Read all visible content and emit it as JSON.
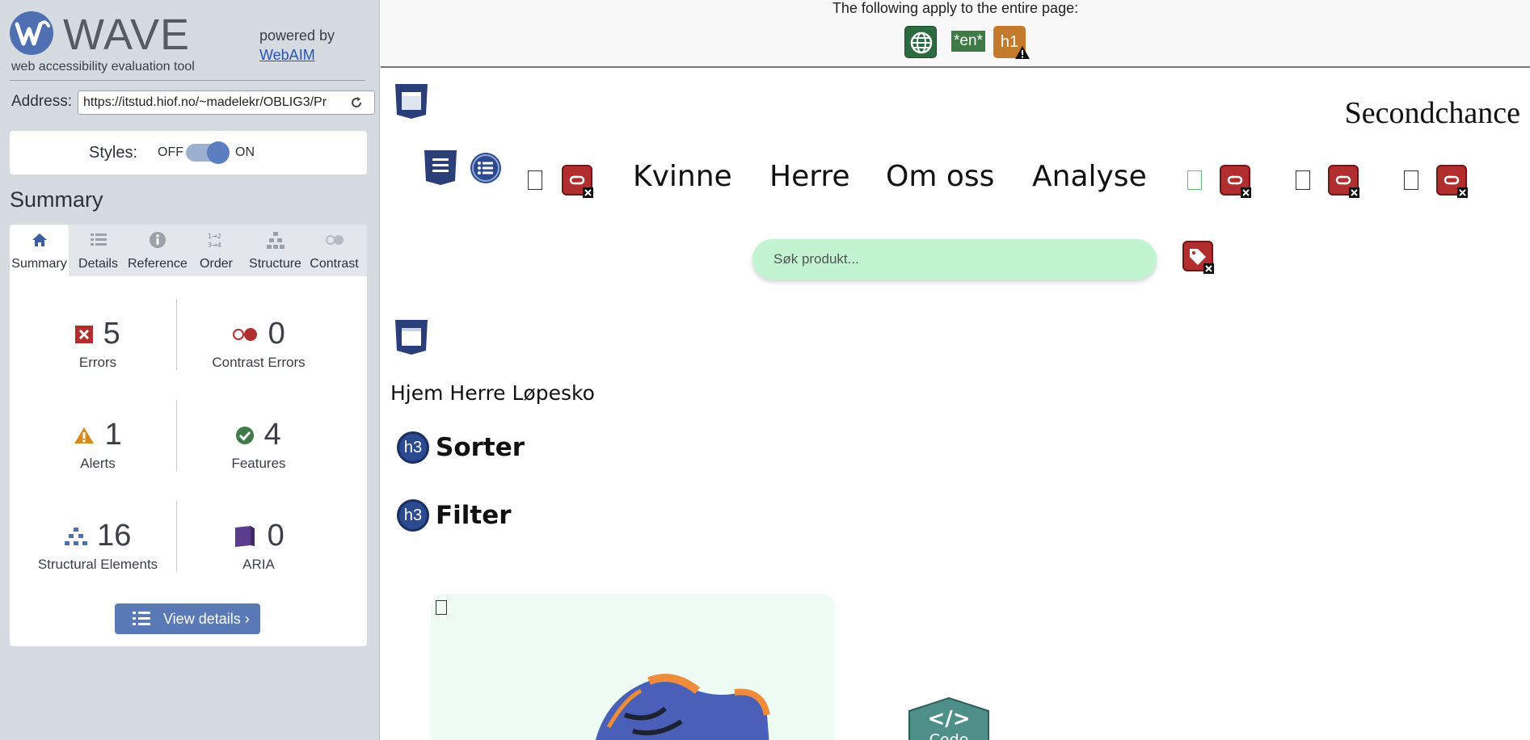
{
  "wave": {
    "title": "WAVE",
    "tagline": "web accessibility evaluation tool",
    "powered_by": "powered by",
    "webaim_link": "WebAIM",
    "address_label": "Address:",
    "address_value": "https://itstud.hiof.no/~madelekr/OBLIG3/Pr",
    "styles_label": "Styles:",
    "styles_off": "OFF",
    "styles_on": "ON",
    "summary_heading": "Summary",
    "tabs": [
      {
        "label": "Summary",
        "icon": "home-icon"
      },
      {
        "label": "Details",
        "icon": "list-icon"
      },
      {
        "label": "Reference",
        "icon": "info-icon"
      },
      {
        "label": "Order",
        "icon": "order-icon"
      },
      {
        "label": "Structure",
        "icon": "structure-icon"
      },
      {
        "label": "Contrast",
        "icon": "contrast-icon"
      }
    ],
    "stats": {
      "errors": {
        "count": "5",
        "label": "Errors"
      },
      "contrast": {
        "count": "0",
        "label": "Contrast Errors"
      },
      "alerts": {
        "count": "1",
        "label": "Alerts"
      },
      "features": {
        "count": "4",
        "label": "Features"
      },
      "structural": {
        "count": "16",
        "label": "Structural Elements"
      },
      "aria": {
        "count": "0",
        "label": "ARIA"
      }
    },
    "view_details": "View details ›",
    "colors": {
      "error": "#b22e2e",
      "alert": "#d88a1e",
      "feature": "#3d7a46",
      "structure": "#4f6fb3",
      "aria": "#5b3d8f",
      "accent": "#5a79b7"
    }
  },
  "page": {
    "banner": "The following apply to the entire page:",
    "banner_icons": [
      "language-icon",
      "*en*",
      "h1"
    ],
    "brand": "Secondchance",
    "nav": [
      "Kvinne",
      "Herre",
      "Om oss",
      "Analyse"
    ],
    "search_placeholder": "Søk produkt...",
    "breadcrumb": "Hjem  Herre  Løpesko",
    "headings": [
      "Sorter",
      "Filter"
    ],
    "h3_badge": "h3",
    "code_label": "Code",
    "code_symbol": "</>"
  }
}
